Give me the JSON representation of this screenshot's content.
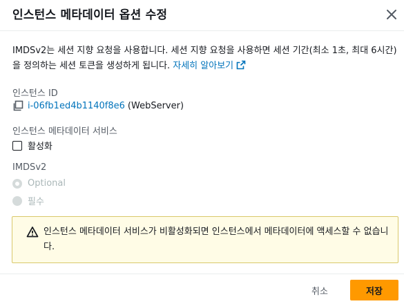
{
  "modal": {
    "title": "인스턴스 메타데이터 옵션 수정"
  },
  "description": {
    "text": "IMDSv2는 세션 지향 요청을 사용합니다. 세션 지향 요청을 사용하면 세션 기간(최소 1초, 최대 6시간)을 정의하는 세션 토큰을 생성하게 됩니다.",
    "link": "자세히 알아보기"
  },
  "instance": {
    "label": "인스턴스 ID",
    "id": "i-06fb1ed4b1140f8e6",
    "name": "(WebServer)"
  },
  "metadata_service": {
    "label": "인스턴스 메타데이터 서비스",
    "checkbox_label": "활성화",
    "checked": false
  },
  "imdsv2": {
    "label": "IMDSv2",
    "options": [
      "Optional",
      "필수"
    ],
    "selected": "Optional",
    "disabled": true
  },
  "alert": {
    "text": "인스턴스 메타데이터 서비스가 비활성화되면 인스턴스에서 메타데이터에 액세스할 수 없습니다."
  },
  "footer": {
    "cancel_label": "취소",
    "save_label": "저장"
  },
  "colors": {
    "link": "#0073bb",
    "primary": "#ff9900",
    "alert_bg": "#fffce6",
    "alert_border": "#d9c86a",
    "disabled": "#aab7b8"
  }
}
